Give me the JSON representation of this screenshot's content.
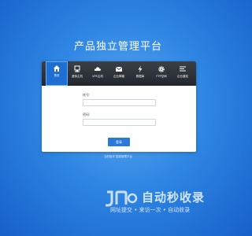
{
  "page": {
    "title": "产品独立管理平台"
  },
  "tabs": [
    {
      "label": "首页",
      "icon": "home-icon",
      "active": true
    },
    {
      "label": "虚拟主机",
      "icon": "server-icon",
      "active": false
    },
    {
      "label": "VPS主机",
      "icon": "cloud-icon",
      "active": false
    },
    {
      "label": "企业邮箱",
      "icon": "mail-icon",
      "active": false
    },
    {
      "label": "数据库",
      "icon": "lightning-icon",
      "active": false
    },
    {
      "label": "FTP空间",
      "icon": "gear-icon",
      "active": false
    },
    {
      "label": "企业建站",
      "icon": "list-icon",
      "active": false
    }
  ],
  "form": {
    "username_label": "帐号:",
    "username_placeholder": "",
    "password_label": "密码:",
    "password_placeholder": "",
    "login_button": "登录"
  },
  "footer_note": "当前版本 智能管理平台",
  "watermark": {
    "brand": "自动秒收录",
    "slogan": "网址提交 • 来访一次 • 自动收录"
  },
  "colors": {
    "accent": "#1f6fd3",
    "bg": "#2f86e3",
    "bar": "#2b2f35"
  }
}
